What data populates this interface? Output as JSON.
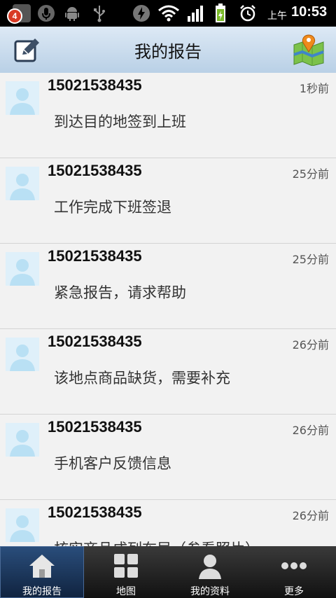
{
  "status_bar": {
    "notification_count": "4",
    "ampm": "上午",
    "time": "10:53",
    "icons": [
      "notification-icon",
      "mic-icon",
      "android-icon",
      "usb-icon",
      "bolt-icon",
      "wifi-icon",
      "signal-icon",
      "battery-icon",
      "alarm-icon"
    ]
  },
  "header": {
    "title": "我的报告",
    "left_icon": "compose-icon",
    "right_icon": "map-icon"
  },
  "reports": [
    {
      "sender": "15021538435",
      "time": "1秒前",
      "message": "到达目的地签到上班"
    },
    {
      "sender": "15021538435",
      "time": "25分前",
      "message": "工作完成下班签退"
    },
    {
      "sender": "15021538435",
      "time": "25分前",
      "message": "紧急报告，请求帮助"
    },
    {
      "sender": "15021538435",
      "time": "26分前",
      "message": "该地点商品缺货，需要补充"
    },
    {
      "sender": "15021538435",
      "time": "26分前",
      "message": "手机客户反馈信息"
    },
    {
      "sender": "15021538435",
      "time": "26分前",
      "message": "核实商品成列布局（参看照片）"
    }
  ],
  "tabs": [
    {
      "label": "我的报告",
      "icon": "home-icon",
      "active": true
    },
    {
      "label": "地图",
      "icon": "grid-icon",
      "active": false
    },
    {
      "label": "我的资料",
      "icon": "person-icon",
      "active": false
    },
    {
      "label": "更多",
      "icon": "more-icon",
      "active": false
    }
  ],
  "colors": {
    "title_bar": "#c8dcef",
    "tab_active": "#1d3a63",
    "tab_bar": "#222222",
    "list_bg": "#f2f2f2"
  }
}
